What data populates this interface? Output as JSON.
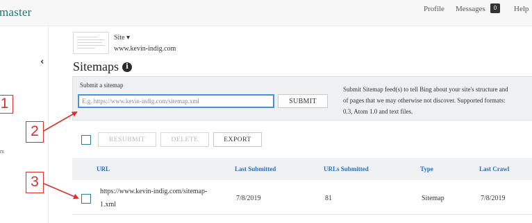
{
  "header": {
    "brand": "master",
    "nav": {
      "profile": "Profile",
      "messages": "Messages",
      "messages_count": "0",
      "help": "Help"
    }
  },
  "sidebar": {
    "collapse_glyph": "‹",
    "fragment_text": "rs"
  },
  "site": {
    "label": "Site ▾",
    "url": "www.kevin-indig.com"
  },
  "page": {
    "title": "Sitemaps",
    "info_glyph": "i"
  },
  "submit_panel": {
    "label": "Submit a sitemap",
    "input_placeholder": "E.g. https://www.kevin-indig.com/sitemap.xml",
    "input_value": "",
    "submit_button": "SUBMIT",
    "help_lines": [
      "Submit Sitemap feed(s) to tell Bing about your site's structure and",
      "of pages that we may otherwise not discover. Supported formats:",
      "0.3, Atom 1.0 and text files."
    ]
  },
  "annotations": [
    "1",
    "2",
    "3"
  ],
  "annotation_color": "#d9302a",
  "toolbar": {
    "resubmit": "RESUBMIT",
    "delete": "DELETE",
    "export": "EXPORT"
  },
  "table": {
    "columns": [
      "URL",
      "Last Submitted",
      "URLs Submitted",
      "Type",
      "Last Crawl"
    ],
    "header_color": "#2a6ebf",
    "rows": [
      {
        "url_line1": "https://www.kevin-indig.com/sitemap-",
        "url_line2": "1.xml",
        "last_submitted": "7/8/2019",
        "urls_submitted": "81",
        "type": "Sitemap",
        "last_crawl": "7/8/2019"
      }
    ]
  }
}
